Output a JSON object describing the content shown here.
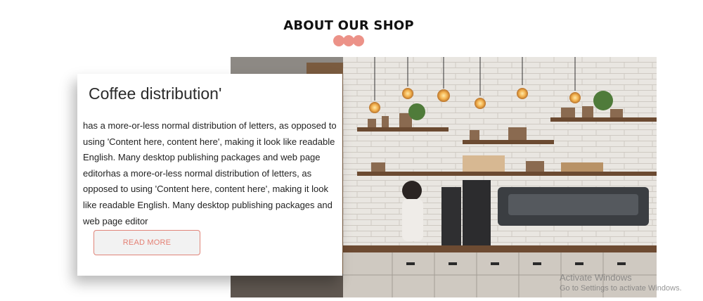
{
  "section": {
    "title": "ABOUT OUR SHOP"
  },
  "card": {
    "heading": "Coffee distribution'",
    "body": "has a more-or-less normal distribution of letters, as opposed to using 'Content here, content here', making it look like readable English. Many desktop publishing packages and web page editorhas a more-or-less normal distribution of letters, as opposed to using 'Content here, content here', making it look like readable English. Many desktop publishing packages and web page editor",
    "button_label": "READ MORE"
  },
  "watermark": {
    "line1": "Activate Windows",
    "line2": "Go to Settings to activate Windows."
  },
  "colors": {
    "accent": "#ec9288",
    "button_border": "#e0857a",
    "heading": "#111111"
  }
}
